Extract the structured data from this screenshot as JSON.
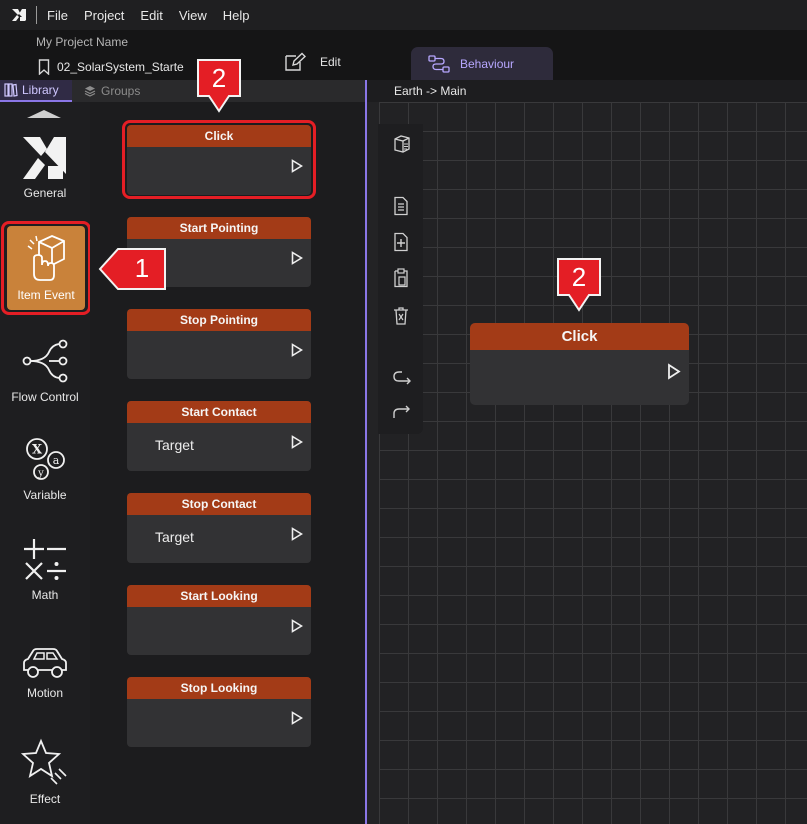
{
  "menubar": {
    "items": [
      "File",
      "Project",
      "Edit",
      "View",
      "Help"
    ]
  },
  "project": {
    "name_label": "My Project Name",
    "file_name": "02_SolarSystem_Starte",
    "edit_label": "Edit",
    "behaviour_label": "Behaviour"
  },
  "library": {
    "tab_library": "Library",
    "tab_groups": "Groups"
  },
  "categories": [
    {
      "label": "General"
    },
    {
      "label": "Item Event"
    },
    {
      "label": "Flow Control"
    },
    {
      "label": "Variable"
    },
    {
      "label": "Math"
    },
    {
      "label": "Motion"
    },
    {
      "label": "Effect"
    }
  ],
  "palette_nodes": [
    {
      "title": "Click",
      "body": ""
    },
    {
      "title": "Start Pointing",
      "body": ""
    },
    {
      "title": "Stop Pointing",
      "body": ""
    },
    {
      "title": "Start Contact",
      "body": "Target"
    },
    {
      "title": "Stop Contact",
      "body": "Target"
    },
    {
      "title": "Start Looking",
      "body": ""
    },
    {
      "title": "Stop Looking",
      "body": ""
    }
  ],
  "canvas": {
    "breadcrumb": "Earth -> Main",
    "node_title": "Click"
  },
  "callouts": {
    "one": "1",
    "two_palette": "2",
    "two_canvas": "2"
  },
  "colors": {
    "accent": "#8a76e6",
    "node_header": "#a33b17",
    "callout_red": "#e41e25",
    "active_category": "#c9823a"
  }
}
